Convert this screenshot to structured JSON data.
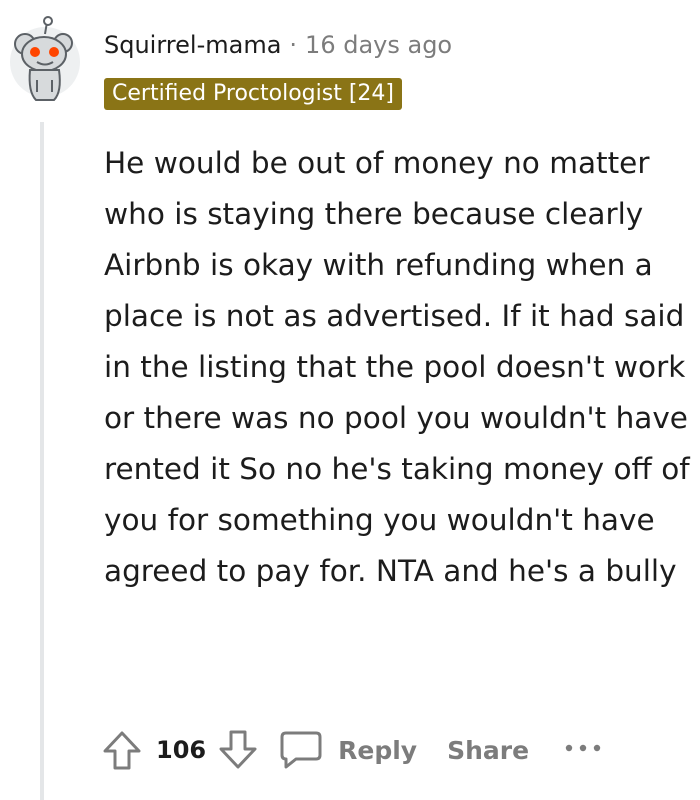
{
  "comment": {
    "author": "Squirrel-mama",
    "separator": "·",
    "age": "16 days ago",
    "flair": "Certified Proctologist [24]",
    "body": "He would be out of money no matter who is staying there because clearly Airbnb is okay with refunding when a place is not as advertised. If it had said in the listing that the pool doesn't work or there was no pool you wouldn't have rented it So no he's taking money off of you for something you wouldn't have agreed to pay for. NTA and he's a bully",
    "score": "106",
    "actions": {
      "reply": "Reply",
      "share": "Share"
    }
  },
  "icons": {
    "avatar": "snoo-avatar",
    "upvote": "arrow-up-icon",
    "downvote": "arrow-down-icon",
    "reply": "speech-bubble-icon",
    "more": "ellipsis-icon"
  },
  "colors": {
    "flair_background": "#8a7416",
    "muted_text": "#7c7c7c",
    "thread_line": "#e4e6e8"
  }
}
